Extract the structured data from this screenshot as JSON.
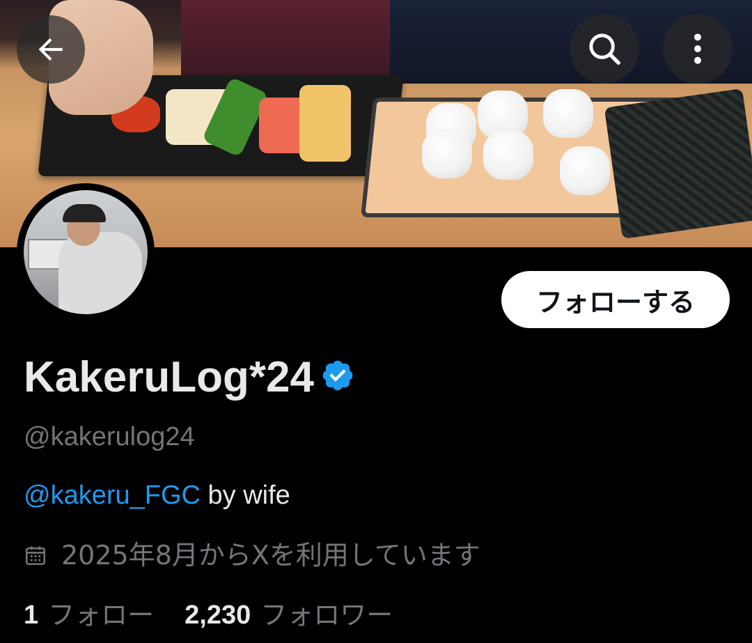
{
  "header": {
    "back_icon": "arrow-left-icon",
    "search_icon": "search-icon",
    "more_icon": "more-vertical-icon"
  },
  "banner": {
    "description_icon": "banner-image"
  },
  "profile": {
    "display_name": "KakeruLog*24",
    "verified_icon": "verified-badge-icon",
    "verified_color": "#1d9bf0",
    "handle": "@kakerulog24",
    "bio_mention": "@kakeru_FGC",
    "bio_text": " by wife",
    "joined_icon": "calendar-icon",
    "joined_text": "2025年8月からXを利用しています",
    "following_count": "1",
    "following_label": "フォロー",
    "followers_count": "2,230",
    "followers_label": "フォロワー"
  },
  "actions": {
    "follow_label": "フォローする"
  },
  "colors": {
    "background": "#000000",
    "primary_text": "#e7e9ea",
    "secondary_text": "#71767b",
    "link": "#1d9bf0"
  }
}
